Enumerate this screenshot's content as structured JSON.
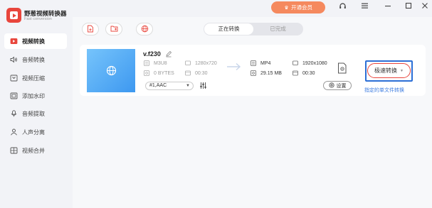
{
  "app": {
    "name": "野葱视频转换器",
    "subtitle": "Fast conversion"
  },
  "header": {
    "vip_label": "开通会员"
  },
  "sidebar": {
    "items": [
      {
        "label": "视频转换",
        "icon": "video-convert-icon",
        "active": true
      },
      {
        "label": "音频转换",
        "icon": "audio-convert-icon"
      },
      {
        "label": "视频压缩",
        "icon": "video-compress-icon"
      },
      {
        "label": "添加水印",
        "icon": "watermark-icon"
      },
      {
        "label": "音频提取",
        "icon": "audio-extract-icon"
      },
      {
        "label": "人声分离",
        "icon": "vocal-separate-icon"
      },
      {
        "label": "视频合并",
        "icon": "video-merge-icon"
      }
    ]
  },
  "tabs": {
    "converting": "正在转换",
    "done": "已完成"
  },
  "file": {
    "name": "v.f230",
    "source": {
      "format": "M3U8",
      "resolution": "1280x720",
      "size": "0 BYTES",
      "duration": "00:30"
    },
    "target": {
      "format": "MP4",
      "resolution": "1920x1080",
      "size": "29.15 MB",
      "duration": "00:30"
    },
    "audio_track": "#1,AAC",
    "settings_label": "设置",
    "convert_label": "极速转换",
    "single_convert_link": "指定的单文件转换"
  },
  "colors": {
    "accent": "#e8453c",
    "vip": "#f5895e",
    "link": "#3b7be0",
    "thumb_start": "#76c4fb",
    "thumb_end": "#3d98f0"
  }
}
